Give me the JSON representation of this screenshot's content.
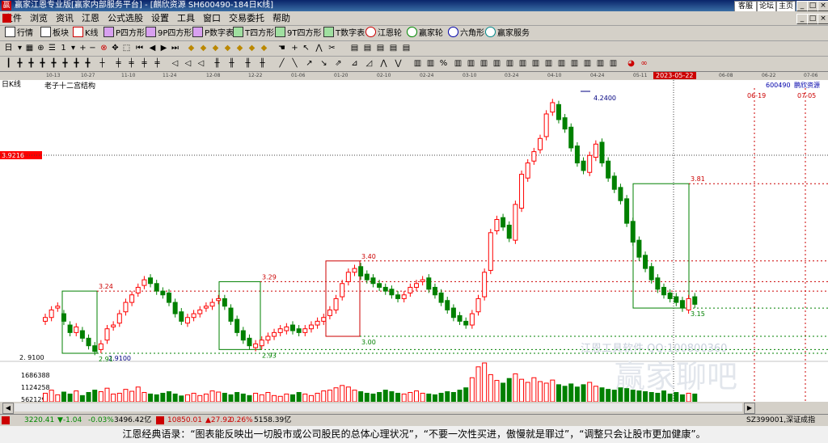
{
  "window": {
    "title": "赢家江恩专业版[赢家内部服务平台] - [麒欣资源  SH600490-184日K线]",
    "top_buttons": [
      "客服",
      "论坛",
      "主页"
    ]
  },
  "menu": [
    "文件",
    "浏览",
    "资讯",
    "江恩",
    "公式选股",
    "设置",
    "工具",
    "窗口",
    "交易委托",
    "帮助"
  ],
  "toolbar1": [
    "行情",
    "板块",
    "K线",
    "P四方形",
    "9P四方形",
    "P数字表",
    "T四方形",
    "9T四方形",
    "T数字表",
    "江恩轮",
    "赢家轮",
    "六角形",
    "赢家服务"
  ],
  "date_axis": [
    "10-13",
    "10-27",
    "11-10",
    "11-24",
    "12-08",
    "12-22",
    "01-06",
    "01-20",
    "02-10",
    "02-24",
    "03-10",
    "03-24",
    "04-10",
    "04-24",
    "05-11",
    "2023-05-22",
    "06-08",
    "06-22",
    "07-06"
  ],
  "chart": {
    "period_label": "日K线",
    "structure_label": "老子十二宫结构",
    "stock_code": "600490",
    "stock_name": "鹏欣资源",
    "cursor_price": "3.9216",
    "high_label": "4.2400",
    "low_label": "2.9100",
    "left_low_value": "2. 9100",
    "dates_upper": [
      "06-19",
      "07-05"
    ],
    "box_labels": [
      "3.24",
      "2.91",
      "3.29",
      "2.93",
      "3.40",
      "3.00",
      "3.81",
      "3.15"
    ],
    "volume_ticks": [
      "1686388",
      "1124258",
      "562129"
    ],
    "watermark_1": "江恩工具软件  QQ:100800360",
    "watermark_2": "赢家聊吧",
    "colors": {
      "up": "#ff0000",
      "down": "#008000",
      "box_red": "#cc0000",
      "box_green": "#008000",
      "guide": "#cc0000",
      "cursor": "#404040"
    }
  },
  "status": {
    "sh_index": "3220.41",
    "sh_change": "▼-1.04",
    "sh_pct": "-0.03%",
    "sh_amount": "3496.42亿",
    "sz_index": "10850.01",
    "sz_change": "▲27.92",
    "sz_pct": "0.26%",
    "sz_amount": "5158.39亿",
    "right_text": "SZ399001,深证成指"
  },
  "bottom_text": "江恩经典语录：“图表能反映出一切股市或公司股民的总体心理状况”，“不要一次性买进，傲慢就是罪过”，“调整只会让股市更加健康”。",
  "chart_data": {
    "type": "candlestick",
    "title": "老子十二宫结构",
    "symbol": "600490",
    "name": "鹏欣资源",
    "period": "日K线",
    "key_prices": {
      "period_high": 4.24,
      "period_low": 2.91,
      "crosshair": 3.9216
    },
    "box_levels": [
      {
        "high": 3.24,
        "low": 2.91
      },
      {
        "high": 3.29,
        "low": 2.93
      },
      {
        "high": 3.4,
        "low": 3.0
      },
      {
        "high": 3.81,
        "low": 3.15
      }
    ],
    "volume_axis_ticks": [
      1686388,
      1124258,
      562129
    ],
    "x_ticks": [
      "10-13",
      "10-27",
      "11-10",
      "11-24",
      "12-08",
      "12-22",
      "01-06",
      "01-20",
      "02-10",
      "02-24",
      "03-10",
      "03-24",
      "04-10",
      "04-24",
      "05-11",
      "2023-05-22",
      "06-08",
      "06-22",
      "07-06"
    ],
    "closes": [
      3.1,
      3.14,
      3.16,
      3.08,
      3.02,
      3.05,
      2.99,
      2.95,
      2.92,
      2.96,
      3.04,
      3.06,
      3.12,
      3.18,
      3.22,
      3.26,
      3.3,
      3.28,
      3.24,
      3.22,
      3.18,
      3.12,
      3.08,
      3.1,
      3.12,
      3.14,
      3.16,
      3.18,
      3.2,
      3.16,
      3.08,
      3.02,
      2.98,
      2.95,
      2.96,
      2.98,
      3.0,
      3.02,
      3.04,
      3.05,
      3.03,
      3.02,
      3.04,
      3.06,
      3.08,
      3.1,
      3.14,
      3.2,
      3.28,
      3.34,
      3.36,
      3.32,
      3.3,
      3.28,
      3.26,
      3.24,
      3.22,
      3.2,
      3.22,
      3.26,
      3.28,
      3.3,
      3.25,
      3.22,
      3.18,
      3.14,
      3.1,
      3.08,
      3.06,
      3.12,
      3.2,
      3.34,
      3.55,
      3.62,
      3.58,
      3.52,
      3.7,
      3.86,
      3.92,
      3.98,
      4.05,
      4.18,
      4.24,
      4.15,
      4.1,
      4.0,
      3.92,
      3.88,
      3.96,
      4.02,
      3.92,
      3.84,
      3.78,
      3.72,
      3.6,
      3.5,
      3.42,
      3.36,
      3.3,
      3.25,
      3.22,
      3.2,
      3.18,
      3.15,
      3.2,
      3.17
    ],
    "opens": [
      3.08,
      3.1,
      3.15,
      3.12,
      3.06,
      3.02,
      3.03,
      2.99,
      2.95,
      2.93,
      2.98,
      3.05,
      3.07,
      3.13,
      3.18,
      3.23,
      3.27,
      3.31,
      3.28,
      3.24,
      3.23,
      3.18,
      3.13,
      3.07,
      3.1,
      3.12,
      3.15,
      3.16,
      3.19,
      3.2,
      3.15,
      3.09,
      3.03,
      2.99,
      2.94,
      2.95,
      2.98,
      3.0,
      3.02,
      3.03,
      3.06,
      3.04,
      3.02,
      3.04,
      3.06,
      3.08,
      3.11,
      3.14,
      3.21,
      3.29,
      3.34,
      3.37,
      3.33,
      3.31,
      3.28,
      3.26,
      3.25,
      3.22,
      3.2,
      3.23,
      3.26,
      3.29,
      3.31,
      3.26,
      3.23,
      3.19,
      3.15,
      3.11,
      3.08,
      3.06,
      3.13,
      3.21,
      3.35,
      3.56,
      3.63,
      3.59,
      3.51,
      3.68,
      3.84,
      3.93,
      3.99,
      4.06,
      4.19,
      4.23,
      4.16,
      4.11,
      4.01,
      3.93,
      3.87,
      3.95,
      4.03,
      3.93,
      3.85,
      3.79,
      3.73,
      3.61,
      3.51,
      3.43,
      3.37,
      3.31,
      3.26,
      3.23,
      3.21,
      3.19,
      3.14,
      3.21
    ],
    "volumes": [
      0.22,
      0.3,
      0.18,
      0.25,
      0.2,
      0.28,
      0.16,
      0.24,
      0.3,
      0.26,
      0.35,
      0.2,
      0.22,
      0.32,
      0.27,
      0.38,
      0.24,
      0.2,
      0.18,
      0.22,
      0.26,
      0.2,
      0.15,
      0.18,
      0.22,
      0.16,
      0.2,
      0.28,
      0.25,
      0.22,
      0.18,
      0.24,
      0.2,
      0.16,
      0.22,
      0.18,
      0.24,
      0.16,
      0.14,
      0.2,
      0.18,
      0.24,
      0.2,
      0.16,
      0.22,
      0.28,
      0.3,
      0.36,
      0.42,
      0.38,
      0.3,
      0.26,
      0.22,
      0.2,
      0.24,
      0.3,
      0.26,
      0.22,
      0.2,
      0.24,
      0.28,
      0.22,
      0.2,
      0.18,
      0.22,
      0.26,
      0.24,
      0.3,
      0.36,
      0.62,
      0.9,
      1.0,
      0.7,
      0.55,
      0.48,
      0.6,
      0.72,
      0.58,
      0.5,
      0.62,
      0.52,
      0.48,
      0.56,
      0.44,
      0.4,
      0.46,
      0.38,
      0.44,
      0.5,
      0.4,
      0.36,
      0.32,
      0.3,
      0.36,
      0.34,
      0.3,
      0.28,
      0.26,
      0.24,
      0.22,
      0.28,
      0.2,
      0.24,
      0.18,
      0.22,
      0.2
    ]
  }
}
